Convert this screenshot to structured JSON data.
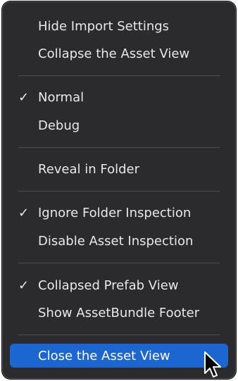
{
  "menu": {
    "items": [
      {
        "label": "Hide Import Settings",
        "checked": false
      },
      {
        "label": "Collapse the Asset View",
        "checked": false
      },
      {
        "label": "Normal",
        "checked": true
      },
      {
        "label": "Debug",
        "checked": false
      },
      {
        "label": "Reveal in Folder",
        "checked": false
      },
      {
        "label": "Ignore Folder Inspection",
        "checked": true
      },
      {
        "label": "Disable Asset Inspection",
        "checked": false
      },
      {
        "label": "Collapsed Prefab View",
        "checked": true
      },
      {
        "label": "Show AssetBundle Footer",
        "checked": false
      },
      {
        "label": "Close the Asset View",
        "checked": false,
        "highlighted": true
      }
    ],
    "check_glyph": "✓"
  },
  "colors": {
    "menu_background": "#2b2b2d",
    "highlight": "#1b66d1",
    "text": "#e8e8e8",
    "separator": "#4e4e52"
  },
  "icons": {
    "cursor": "arrow-cursor-icon"
  }
}
